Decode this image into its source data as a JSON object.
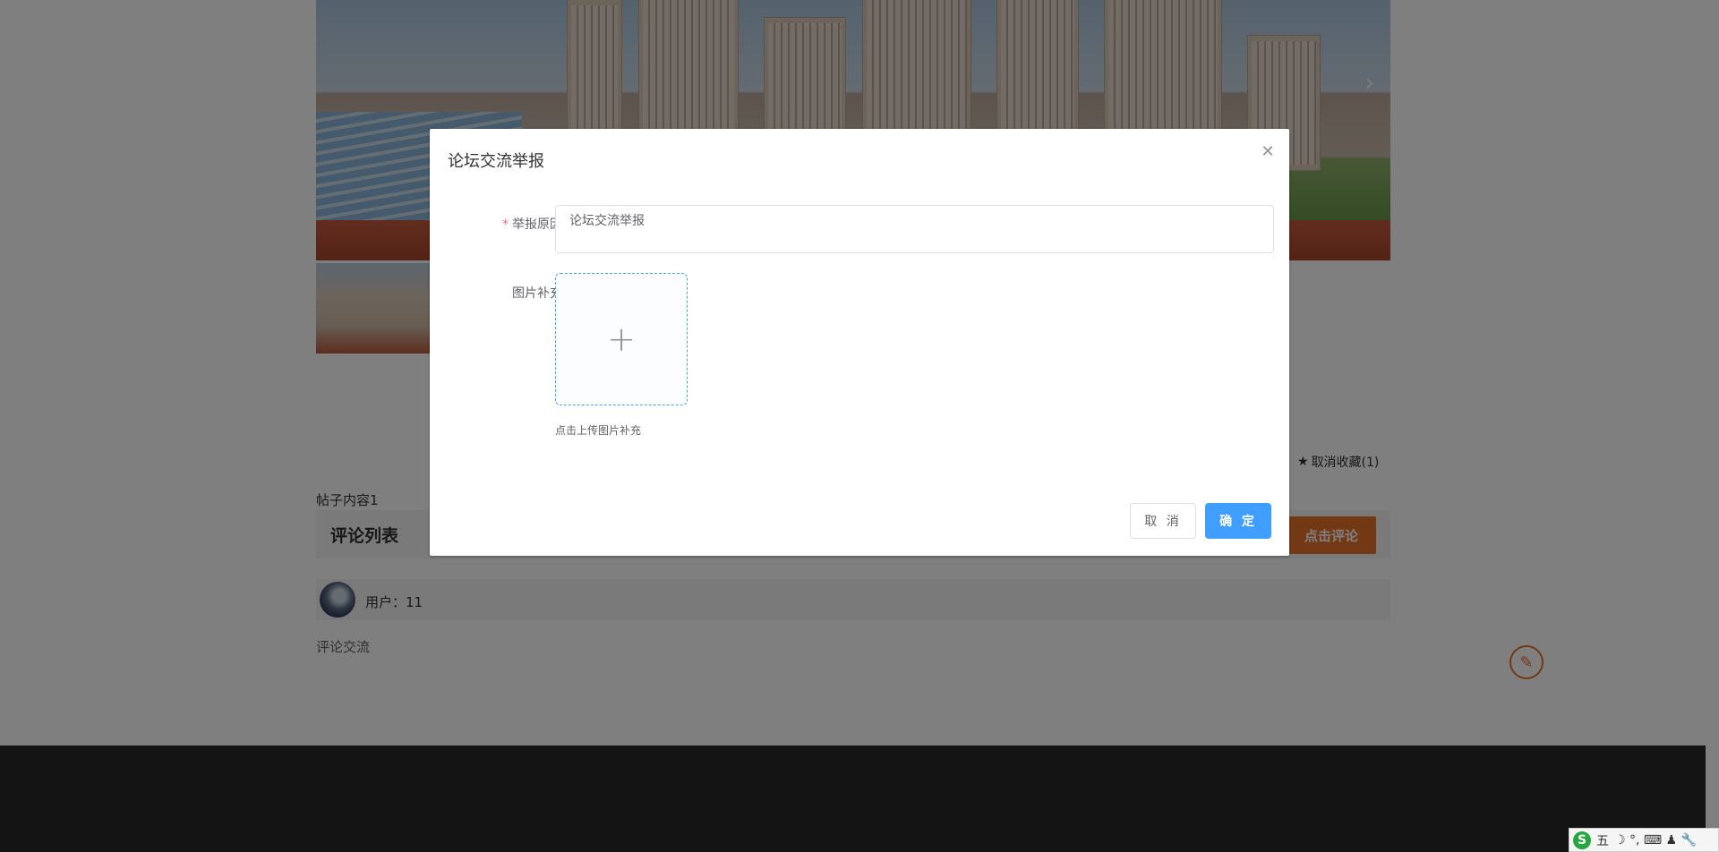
{
  "carousel": {
    "next_icon": "chevron-right-icon"
  },
  "post": {
    "favorite_label": "取消收藏(1)",
    "content": "帖子内容1"
  },
  "comments": {
    "section_title": "评论列表",
    "comment_button": "点击评论",
    "items": [
      {
        "user_label": "用户：11",
        "text": "评论交流"
      }
    ]
  },
  "dialog": {
    "title": "论坛交流举报",
    "reason_label": "举报原因",
    "required_mark": "*",
    "reason_value": "论坛交流举报",
    "image_label": "图片补充",
    "upload_tip": "点击上传图片补充",
    "cancel_label": "取 消",
    "confirm_label": "确 定"
  },
  "ime": {
    "logo": "S",
    "mode": "五",
    "symbols": "☽ °, ⌨ ♟ 🔧"
  },
  "colors": {
    "primary": "#409eff",
    "accent": "#e6732a",
    "required": "#f56c6c",
    "footer": "#282828"
  }
}
